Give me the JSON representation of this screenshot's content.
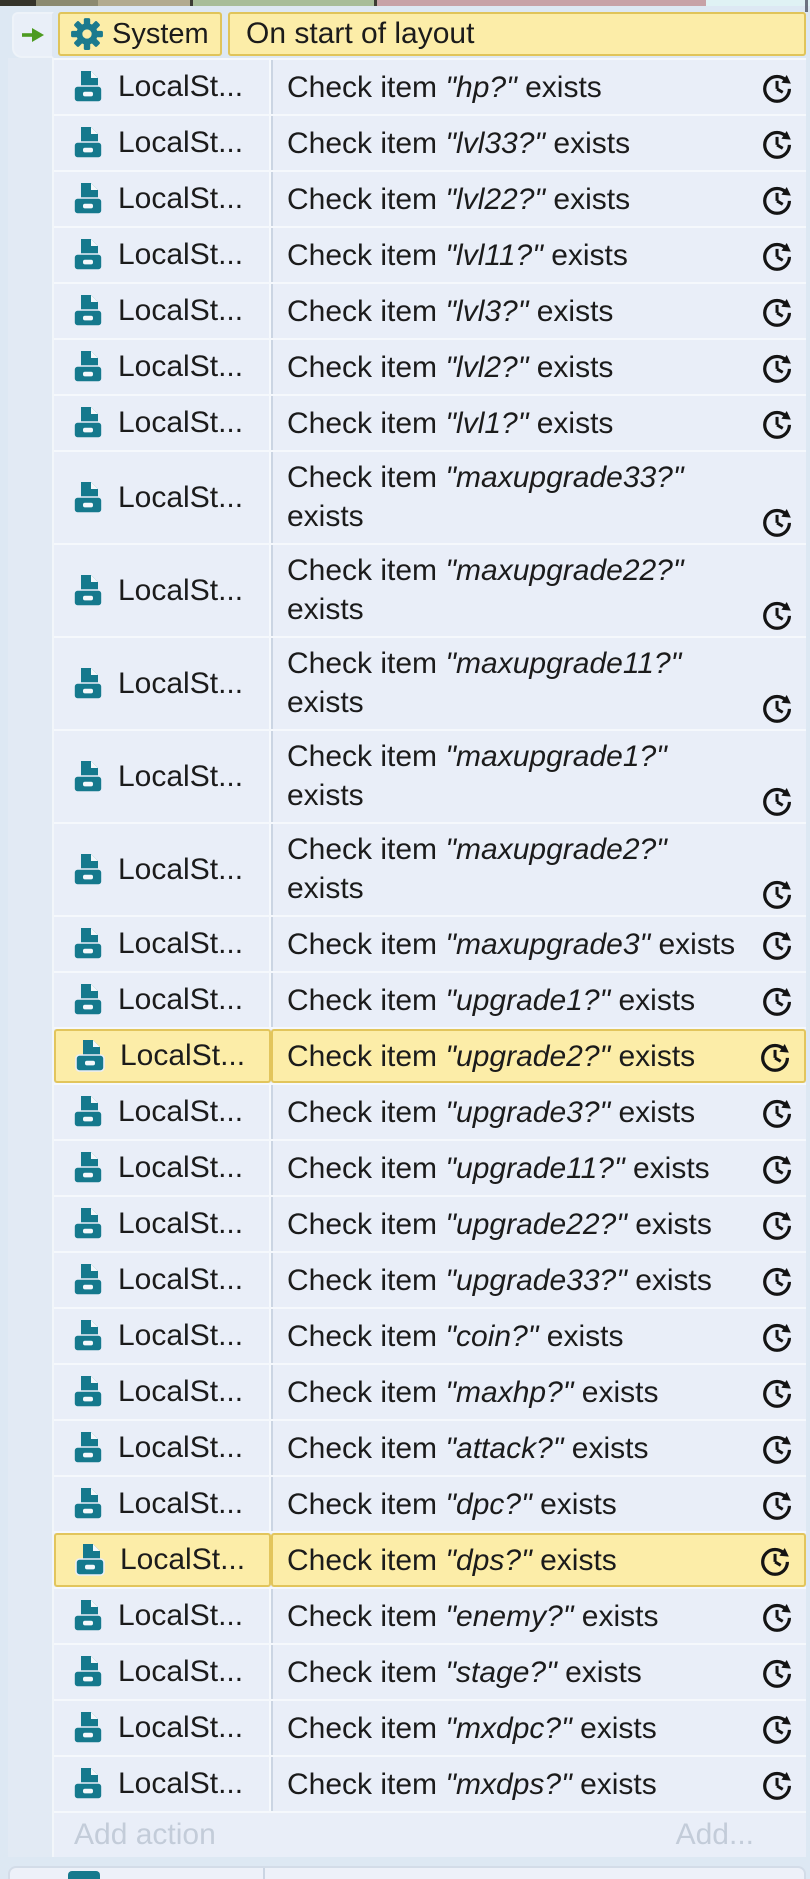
{
  "header": {
    "object": "System",
    "condition": "On start of layout"
  },
  "actions": [
    {
      "object": "LocalSt...",
      "prefix": "Check item",
      "item": "\"hp?\"",
      "suffix": "exists",
      "wrap": false,
      "highlighted": false,
      "async": true
    },
    {
      "object": "LocalSt...",
      "prefix": "Check item",
      "item": "\"lvl33?\"",
      "suffix": "exists",
      "wrap": false,
      "highlighted": false,
      "async": true
    },
    {
      "object": "LocalSt...",
      "prefix": "Check item",
      "item": "\"lvl22?\"",
      "suffix": "exists",
      "wrap": false,
      "highlighted": false,
      "async": true
    },
    {
      "object": "LocalSt...",
      "prefix": "Check item",
      "item": "\"lvl11?\"",
      "suffix": "exists",
      "wrap": false,
      "highlighted": false,
      "async": true
    },
    {
      "object": "LocalSt...",
      "prefix": "Check item",
      "item": "\"lvl3?\"",
      "suffix": "exists",
      "wrap": false,
      "highlighted": false,
      "async": true
    },
    {
      "object": "LocalSt...",
      "prefix": "Check item",
      "item": "\"lvl2?\"",
      "suffix": "exists",
      "wrap": false,
      "highlighted": false,
      "async": true
    },
    {
      "object": "LocalSt...",
      "prefix": "Check item",
      "item": "\"lvl1?\"",
      "suffix": "exists",
      "wrap": false,
      "highlighted": false,
      "async": true
    },
    {
      "object": "LocalSt...",
      "prefix": "Check item",
      "item": "\"maxupgrade33?\"",
      "suffix": "exists",
      "wrap": true,
      "highlighted": false,
      "async": true
    },
    {
      "object": "LocalSt...",
      "prefix": "Check item",
      "item": "\"maxupgrade22?\"",
      "suffix": "exists",
      "wrap": true,
      "highlighted": false,
      "async": true
    },
    {
      "object": "LocalSt...",
      "prefix": "Check item",
      "item": "\"maxupgrade11?\"",
      "suffix": "exists",
      "wrap": true,
      "highlighted": false,
      "async": true
    },
    {
      "object": "LocalSt...",
      "prefix": "Check item",
      "item": "\"maxupgrade1?\"",
      "suffix": "exists",
      "wrap": true,
      "highlighted": false,
      "async": true
    },
    {
      "object": "LocalSt...",
      "prefix": "Check item",
      "item": "\"maxupgrade2?\"",
      "suffix": "exists",
      "wrap": true,
      "highlighted": false,
      "async": true
    },
    {
      "object": "LocalSt...",
      "prefix": "Check item",
      "item": "\"maxupgrade3\"",
      "suffix": "exists",
      "wrap": false,
      "highlighted": false,
      "async": true
    },
    {
      "object": "LocalSt...",
      "prefix": "Check item",
      "item": "\"upgrade1?\"",
      "suffix": "exists",
      "wrap": false,
      "highlighted": false,
      "async": true
    },
    {
      "object": "LocalSt...",
      "prefix": "Check item",
      "item": "\"upgrade2?\"",
      "suffix": "exists",
      "wrap": false,
      "highlighted": true,
      "async": true
    },
    {
      "object": "LocalSt...",
      "prefix": "Check item",
      "item": "\"upgrade3?\"",
      "suffix": "exists",
      "wrap": false,
      "highlighted": false,
      "async": true
    },
    {
      "object": "LocalSt...",
      "prefix": "Check item",
      "item": "\"upgrade11?\"",
      "suffix": "exists",
      "wrap": false,
      "highlighted": false,
      "async": true
    },
    {
      "object": "LocalSt...",
      "prefix": "Check item",
      "item": "\"upgrade22?\"",
      "suffix": "exists",
      "wrap": false,
      "highlighted": false,
      "async": true
    },
    {
      "object": "LocalSt...",
      "prefix": "Check item",
      "item": "\"upgrade33?\"",
      "suffix": "exists",
      "wrap": false,
      "highlighted": false,
      "async": true
    },
    {
      "object": "LocalSt...",
      "prefix": "Check item",
      "item": "\"coin?\"",
      "suffix": "exists",
      "wrap": false,
      "highlighted": false,
      "async": true
    },
    {
      "object": "LocalSt...",
      "prefix": "Check item",
      "item": "\"maxhp?\"",
      "suffix": "exists",
      "wrap": false,
      "highlighted": false,
      "async": true
    },
    {
      "object": "LocalSt...",
      "prefix": "Check item",
      "item": "\"attack?\"",
      "suffix": "exists",
      "wrap": false,
      "highlighted": false,
      "async": true
    },
    {
      "object": "LocalSt...",
      "prefix": "Check item",
      "item": "\"dpc?\"",
      "suffix": "exists",
      "wrap": false,
      "highlighted": false,
      "async": true
    },
    {
      "object": "LocalSt...",
      "prefix": "Check item",
      "item": "\"dps?\"",
      "suffix": "exists",
      "wrap": false,
      "highlighted": true,
      "async": true
    },
    {
      "object": "LocalSt...",
      "prefix": "Check item",
      "item": "\"enemy?\"",
      "suffix": "exists",
      "wrap": false,
      "highlighted": false,
      "async": true
    },
    {
      "object": "LocalSt...",
      "prefix": "Check item",
      "item": "\"stage?\"",
      "suffix": "exists",
      "wrap": false,
      "highlighted": false,
      "async": true
    },
    {
      "object": "LocalSt...",
      "prefix": "Check item",
      "item": "\"mxdpc?\"",
      "suffix": "exists",
      "wrap": false,
      "highlighted": false,
      "async": true
    },
    {
      "object": "LocalSt...",
      "prefix": "Check item",
      "item": "\"mxdps?\"",
      "suffix": "exists",
      "wrap": false,
      "highlighted": false,
      "async": true
    }
  ],
  "footer": {
    "add_action": "Add action",
    "add_more": "Add..."
  },
  "colors": {
    "highlight_yellow": "#fceda8",
    "highlight_border": "#e2c55c",
    "object_teal": "#15798d",
    "arrow_green": "#4d9b20",
    "row_background": "#e9eef8",
    "page_background": "#dde8f3"
  }
}
